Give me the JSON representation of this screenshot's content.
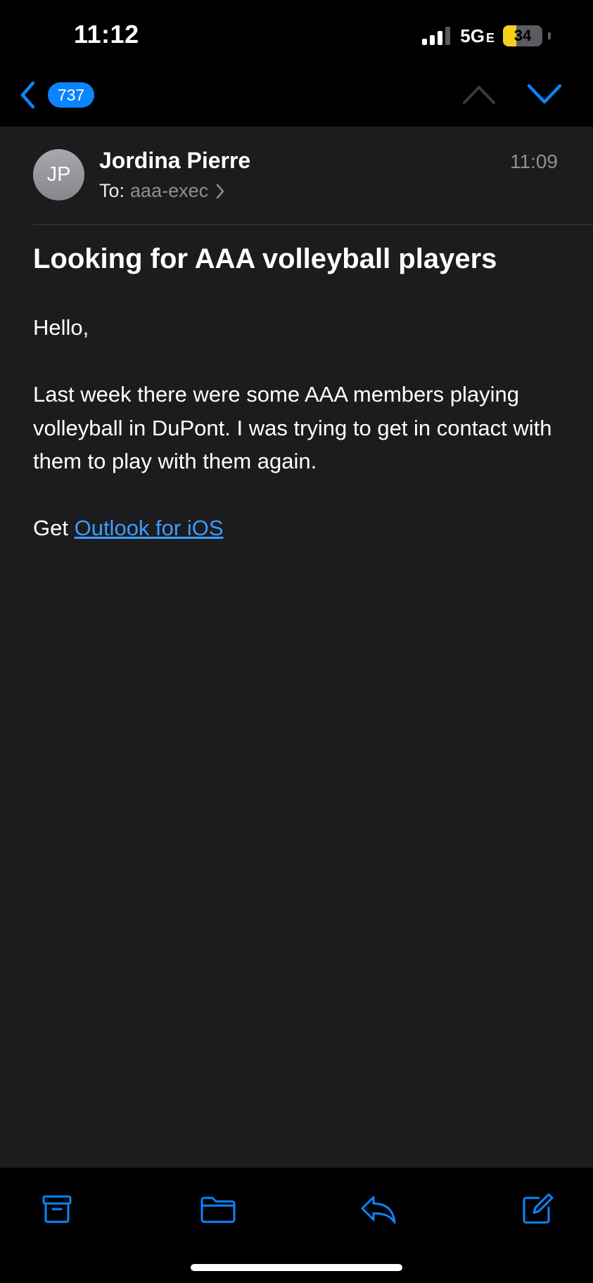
{
  "status_bar": {
    "time": "11:12",
    "network": "5G",
    "network_suffix": "E",
    "battery": "34",
    "battery_level": 0.34,
    "battery_color": "#f5d01c"
  },
  "nav": {
    "back_icon": "chevron-left-icon",
    "unread_count": "737",
    "prev_icon": "chevron-up-icon",
    "next_icon": "chevron-down-icon",
    "accent": "#0a84ff"
  },
  "message": {
    "avatar_initials": "JP",
    "sender": "Jordina Pierre",
    "to_label": "To:",
    "to_value": "aaa-exec",
    "time": "11:09",
    "subject": "Looking for AAA volleyball players",
    "greeting": "Hello,",
    "paragraph": "Last week there were some AAA members playing volleyball in DuPont. I was trying to get in contact with them to play with them again.",
    "signature_prefix": "Get",
    "signature_link": "Outlook for iOS"
  },
  "toolbar": {
    "items": [
      {
        "icon": "archive-icon"
      },
      {
        "icon": "folder-icon"
      },
      {
        "icon": "reply-icon"
      },
      {
        "icon": "compose-icon"
      }
    ]
  }
}
